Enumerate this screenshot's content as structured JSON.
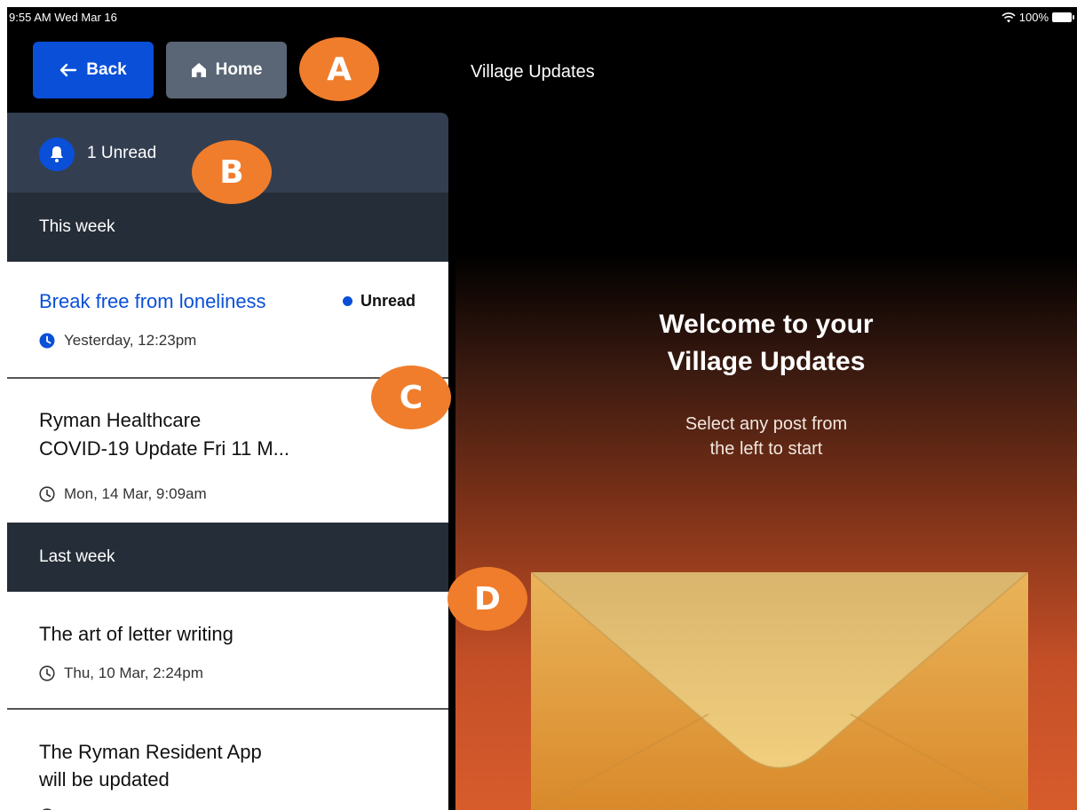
{
  "status_bar": {
    "time_date": "9:55 AM  Wed Mar 16",
    "battery": "100%"
  },
  "nav": {
    "back_label": "Back",
    "home_label": "Home"
  },
  "window_title": "Village Updates",
  "annotations": {
    "a": "A",
    "b": "B",
    "c": "C",
    "d": "D"
  },
  "unread": {
    "label": "1 Unread"
  },
  "sections": [
    {
      "heading": "This week",
      "posts": [
        {
          "title": "Break free from loneliness",
          "status": "Unread",
          "time": "Yesterday, 12:23pm"
        },
        {
          "title_line1": "Ryman Healthcare",
          "title_line2": "COVID-19 Update Fri 11 M...",
          "time": "Mon, 14 Mar, 9:09am"
        }
      ]
    },
    {
      "heading": "Last week",
      "posts": [
        {
          "title": "The art of letter writing",
          "time": "Thu, 10 Mar, 2:24pm"
        },
        {
          "title_line1": "The Ryman Resident App",
          "title_line2": "will be updated"
        }
      ]
    }
  ],
  "welcome": {
    "title_line1": "Welcome to your",
    "title_line2": "Village Updates",
    "sub_line1": "Select any post from",
    "sub_line2": "the left to start"
  },
  "colors": {
    "accent": "#0a4fd8",
    "badge": "#f07d2c"
  },
  "icons": [
    "arrow-left-icon",
    "home-icon",
    "bell-icon",
    "clock-icon",
    "unread-dot-icon",
    "wifi-icon",
    "battery-icon",
    "envelope-illustration"
  ]
}
